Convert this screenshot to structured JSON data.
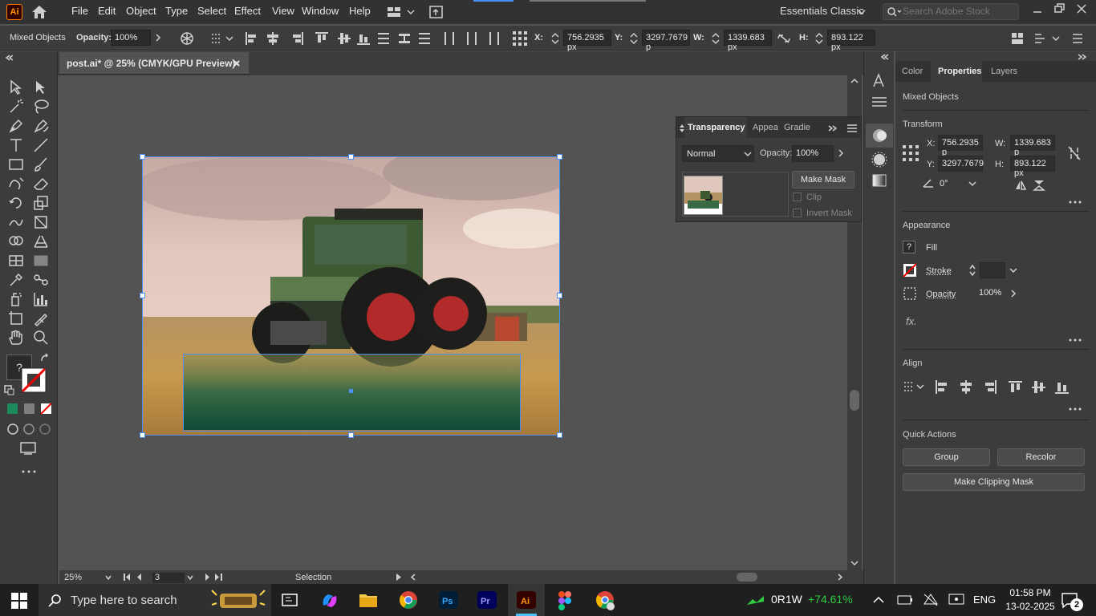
{
  "app": {
    "logo": "Ai",
    "doc_title": "post.ai* @ 25% (CMYK/GPU Preview)"
  },
  "menu": [
    "File",
    "Edit",
    "Object",
    "Type",
    "Select",
    "Effect",
    "View",
    "Window",
    "Help"
  ],
  "workspace": "Essentials Classic",
  "search": {
    "placeholder": "Search Adobe Stock"
  },
  "control": {
    "selection": "Mixed Objects",
    "opacity_label": "Opacity:",
    "opacity": "100%",
    "x_label": "X:",
    "x": "756.2935 px",
    "y_label": "Y:",
    "y": "3297.7679 p",
    "w_label": "W:",
    "w": "1339.683 px",
    "h_label": "H:",
    "h": "893.122 px"
  },
  "transparency": {
    "tabs": [
      "Transparency",
      "Appea",
      "Gradie"
    ],
    "blend": "Normal",
    "opacity_label": "Opacity:",
    "opacity": "100%",
    "make_mask": "Make Mask",
    "clip": "Clip",
    "invert_mask": "Invert Mask"
  },
  "properties": {
    "tabs": [
      "Color",
      "Properties",
      "Layers"
    ],
    "selection": "Mixed Objects",
    "transform": {
      "title": "Transform",
      "x_label": "X:",
      "x": "756.2935 p",
      "y_label": "Y:",
      "y": "3297.7679",
      "w_label": "W:",
      "w": "1339.683 p",
      "h_label": "H:",
      "h": "893.122 px",
      "angle": "0°"
    },
    "appearance": {
      "title": "Appearance",
      "fill": "Fill",
      "stroke": "Stroke",
      "opacity_label": "Opacity",
      "opacity": "100%",
      "fx": "fx."
    },
    "align": {
      "title": "Align"
    },
    "quick_actions": {
      "title": "Quick Actions",
      "group": "Group",
      "recolor": "Recolor",
      "clipping_mask": "Make Clipping Mask"
    }
  },
  "status": {
    "zoom": "25%",
    "artboard": "3",
    "tool": "Selection"
  },
  "taskbar": {
    "search_placeholder": "Type here to search",
    "stock_ticker": "0R1W",
    "stock_change": "+74.61%",
    "lang": "ENG",
    "time": "01:58 PM",
    "date": "13-02-2025",
    "notifications": "2"
  },
  "colors": {
    "accent": "#4b8ef5",
    "ai_orange": "#ff9a00",
    "stock_green": "#2ecc40"
  }
}
